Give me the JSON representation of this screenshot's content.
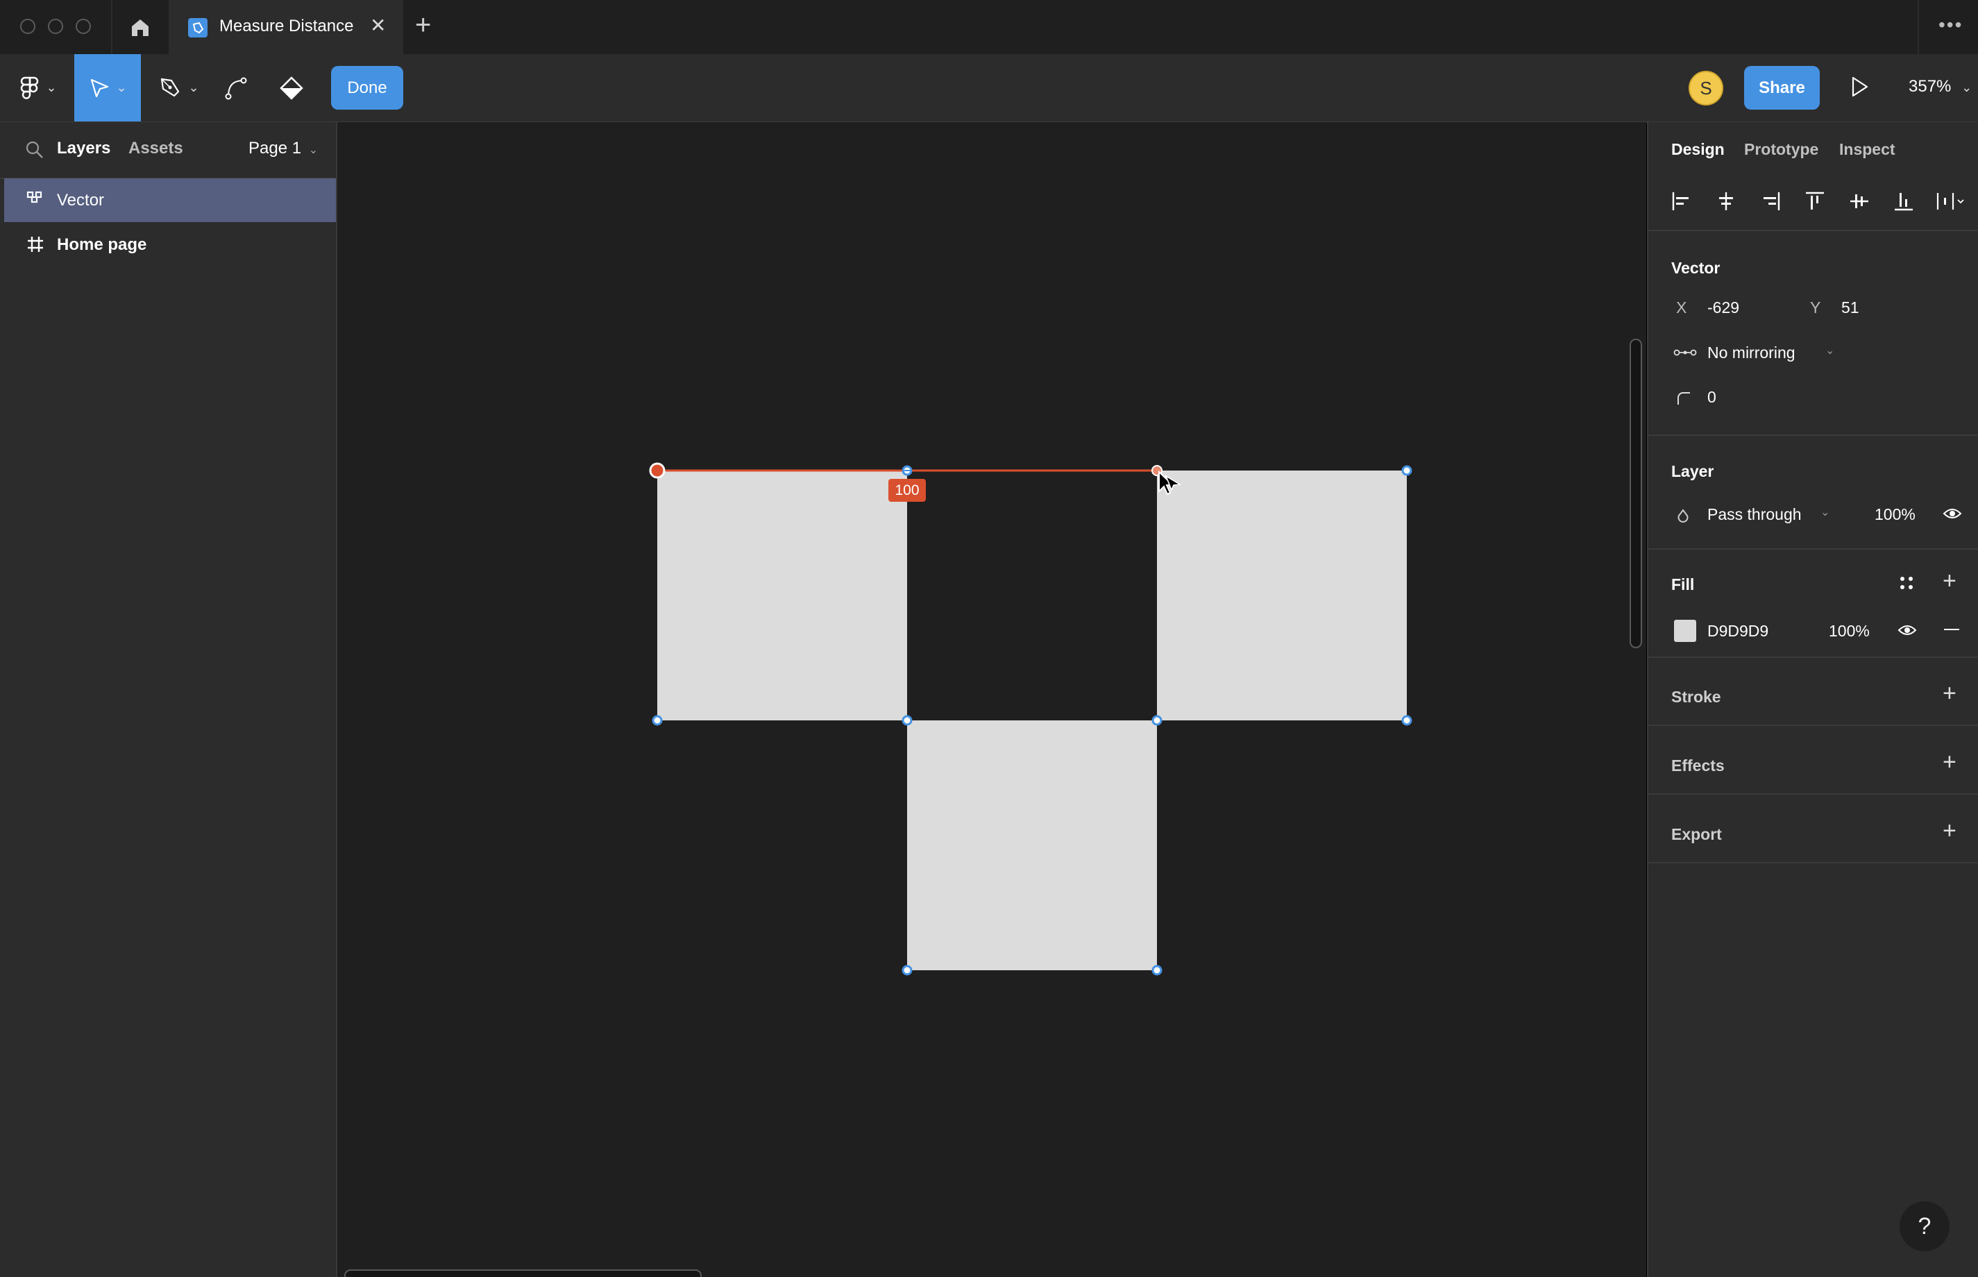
{
  "window": {
    "tab_title": "Measure Distance",
    "tab_icon": "figma-file-icon",
    "new_tab_label": "+",
    "close_tab_label": "✕",
    "more_label": "•••"
  },
  "toolbar": {
    "main_menu_icon": "figma-logo-icon",
    "move_tool_icon": "move-arrow-icon",
    "pen_tool_icon": "pen-icon",
    "bend_tool_icon": "bend-curve-icon",
    "paint_bucket_icon": "paint-bucket-icon",
    "done_label": "Done",
    "avatar_initial": "S",
    "share_label": "Share",
    "present_icon": "play-icon",
    "zoom_level": "357%"
  },
  "left_panel": {
    "tabs": [
      {
        "label": "Layers",
        "active": true
      },
      {
        "label": "Assets",
        "active": false
      }
    ],
    "page_selector": "Page 1",
    "layers": [
      {
        "name": "Vector",
        "icon": "vector-icon",
        "selected": true
      },
      {
        "name": "Home page",
        "icon": "frame-icon",
        "selected": false
      }
    ]
  },
  "canvas": {
    "measure_label": "100",
    "fill_color": "#D9D9D9",
    "measure_color": "#D9502E",
    "selection_color": "#4592E2"
  },
  "right_panel": {
    "tabs": [
      {
        "label": "Design",
        "active": true
      },
      {
        "label": "Prototype",
        "active": false
      },
      {
        "label": "Inspect",
        "active": false
      }
    ],
    "align_icons": [
      "align-left-icon",
      "align-horizontal-center-icon",
      "align-right-icon",
      "align-top-icon",
      "align-vertical-center-icon",
      "align-bottom-icon",
      "distribute-icon"
    ],
    "vector": {
      "title": "Vector",
      "x_label": "X",
      "x_value": "-629",
      "y_label": "Y",
      "y_value": "51",
      "mirroring": "No mirroring",
      "corner_radius": "0"
    },
    "layer": {
      "title": "Layer",
      "blend_mode": "Pass through",
      "opacity": "100%"
    },
    "fill": {
      "title": "Fill",
      "hex": "D9D9D9",
      "opacity": "100%",
      "swatch_color": "#D9D9D9"
    },
    "stroke": {
      "title": "Stroke"
    },
    "effects": {
      "title": "Effects"
    },
    "export": {
      "title": "Export"
    }
  },
  "help_label": "?"
}
